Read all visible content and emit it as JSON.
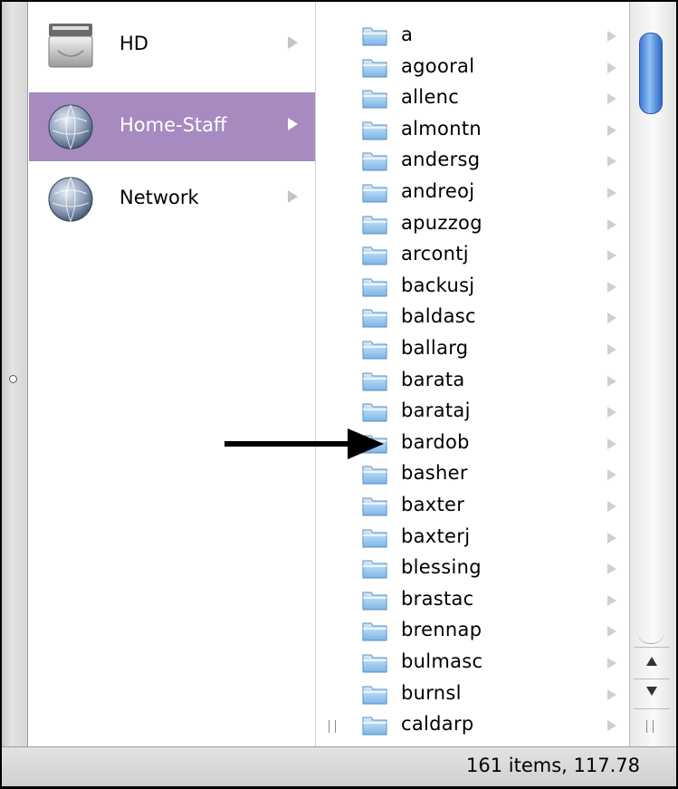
{
  "sidebar": {
    "items": [
      {
        "label": "HD",
        "icon": "hard-drive-icon",
        "selected": false
      },
      {
        "label": "Home-Staff",
        "icon": "network-globe-icon",
        "selected": true
      },
      {
        "label": "Network",
        "icon": "network-globe-icon",
        "selected": false
      }
    ]
  },
  "folders": {
    "items": [
      "a",
      "agooral",
      "allenc",
      "almontn",
      "andersg",
      "andreoj",
      "apuzzog",
      "arcontj",
      "backusj",
      "baldasc",
      "ballarg",
      "barata",
      "barataj",
      "bardob",
      "basher",
      "baxter",
      "baxterj",
      "blessing",
      "brastac",
      "brennap",
      "bulmasc",
      "burnsl",
      "caldarp"
    ]
  },
  "status": {
    "text": "161 items, 117.78"
  },
  "colors": {
    "selection": "#a68ac0",
    "scroll_thumb": "#4a86dc"
  }
}
